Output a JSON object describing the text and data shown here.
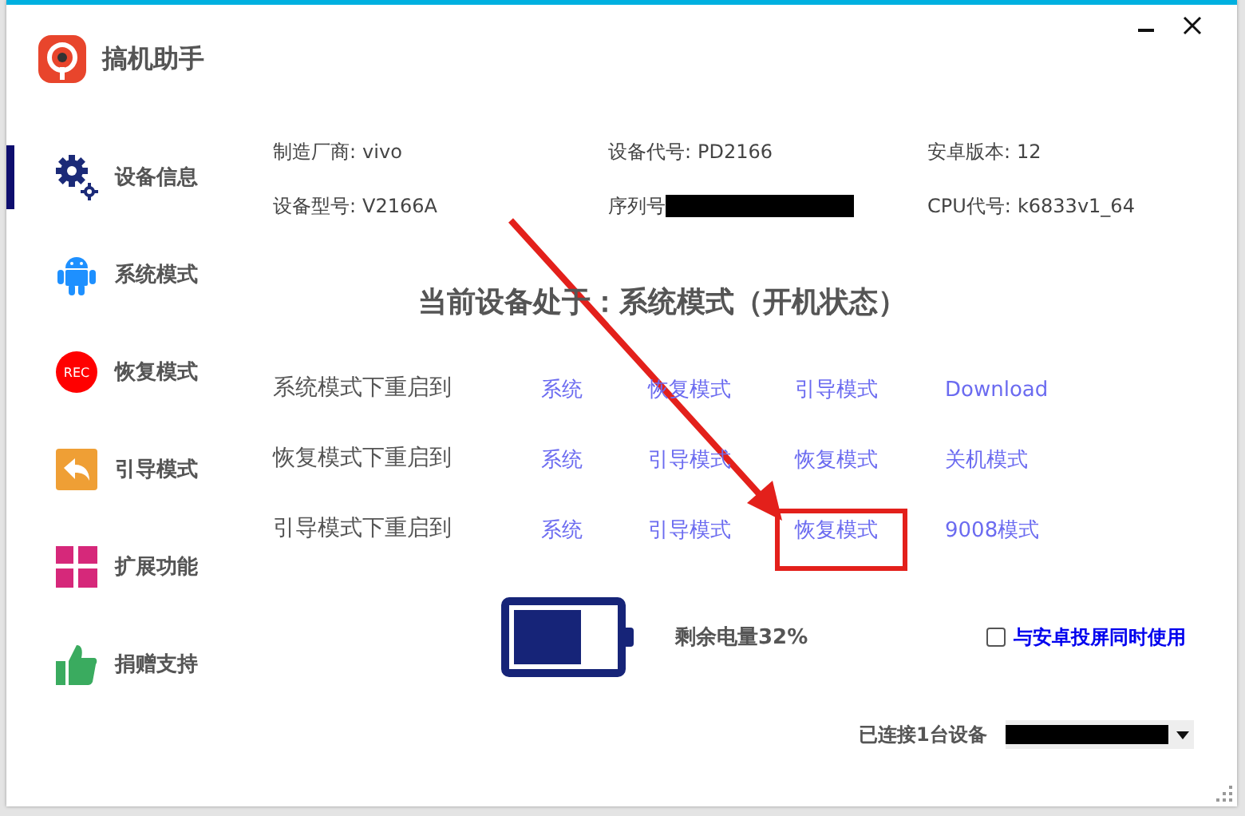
{
  "app": {
    "title": "搞机助手"
  },
  "sidebar": {
    "items": [
      {
        "label": "设备信息",
        "selected": true
      },
      {
        "label": "系统模式",
        "selected": false
      },
      {
        "label": "恢复模式",
        "icon_text": "REC",
        "selected": false
      },
      {
        "label": "引导模式",
        "selected": false
      },
      {
        "label": "扩展功能",
        "selected": false
      },
      {
        "label": "捐赠支持",
        "selected": false
      }
    ]
  },
  "device_info": [
    {
      "label": "制造厂商:",
      "value": "vivo"
    },
    {
      "label": "设备代号:",
      "value": "PD2166"
    },
    {
      "label": "安卓版本:",
      "value": "12"
    },
    {
      "label": "设备型号:",
      "value": "V2166A"
    },
    {
      "label": "序列号",
      "redacted": true
    },
    {
      "label": "CPU代号:",
      "value": "k6833v1_64"
    }
  ],
  "status_heading": "当前设备处于：系统模式（开机状态）",
  "reboot_rows": [
    {
      "label": "系统模式下重启到",
      "targets": [
        "系统",
        "恢复模式",
        "引导模式",
        "Download"
      ]
    },
    {
      "label": "恢复模式下重启到",
      "targets": [
        "系统",
        "引导模式",
        "恢复模式",
        "关机模式"
      ]
    },
    {
      "label": "引导模式下重启到",
      "targets": [
        "系统",
        "引导模式",
        "恢复模式",
        "9008模式"
      ]
    }
  ],
  "battery": {
    "level": 0.67,
    "label": "剩余电量32%"
  },
  "screen_mirror": {
    "label": "与安卓投屏同时使用",
    "checked": false
  },
  "connection": {
    "label": "已连接1台设备"
  }
}
